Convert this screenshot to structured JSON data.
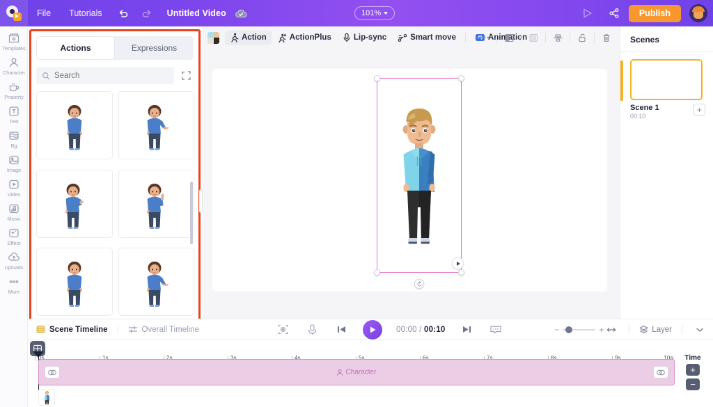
{
  "app": {
    "logo_icon": "animaker-logo-icon",
    "menu": [
      "File",
      "Tutorials"
    ],
    "undo_icon": "undo-icon",
    "redo_icon": "redo-icon",
    "doc_title": "Untitled Video",
    "cloud_icon": "cloud-saved-icon",
    "zoom_level": "101%",
    "preview_icon": "preview-play-icon",
    "share_icon": "share-icon",
    "publish_label": "Publish",
    "avatar_name": "user-avatar",
    "accent_purple": "#7b45ec",
    "publish_orange": "#f6982f"
  },
  "rail": {
    "items": [
      {
        "label": "Templates",
        "icon": "templates-icon"
      },
      {
        "label": "Character",
        "icon": "character-icon"
      },
      {
        "label": "Property",
        "icon": "property-icon"
      },
      {
        "label": "Text",
        "icon": "text-icon"
      },
      {
        "label": "Bg",
        "icon": "background-icon"
      },
      {
        "label": "Image",
        "icon": "image-icon"
      },
      {
        "label": "Video",
        "icon": "video-icon"
      },
      {
        "label": "Music",
        "icon": "music-icon"
      },
      {
        "label": "Effect",
        "icon": "effect-icon"
      },
      {
        "label": "Uploads",
        "icon": "uploads-icon"
      },
      {
        "label": "More",
        "icon": "more-icon"
      }
    ]
  },
  "panel": {
    "highlight_color": "#e8421f",
    "tabs": [
      {
        "label": "Actions",
        "active": true
      },
      {
        "label": "Expressions",
        "active": false
      }
    ],
    "search": {
      "placeholder": "Search",
      "value": "",
      "icon": "search-icon"
    },
    "expand_icon": "expand-icon",
    "thumbnails": [
      {
        "name": "action-thumb-1",
        "pose": "idle"
      },
      {
        "name": "action-thumb-2",
        "pose": "present-right"
      },
      {
        "name": "action-thumb-3",
        "pose": "hand-up"
      },
      {
        "name": "action-thumb-4",
        "pose": "point-up"
      },
      {
        "name": "action-thumb-5",
        "pose": "idle"
      },
      {
        "name": "action-thumb-6",
        "pose": "present-right"
      }
    ]
  },
  "canvas_toolbar": {
    "color_swatch": "color-swatch",
    "buttons": [
      {
        "label": "Action",
        "icon": "action-icon",
        "active": true
      },
      {
        "label": "ActionPlus",
        "icon": "action-plus-icon",
        "active": false
      },
      {
        "label": "Lip-sync",
        "icon": "microphone-icon",
        "active": false
      },
      {
        "label": "Smart move",
        "icon": "smart-move-icon",
        "active": false
      },
      {
        "label": "Animation",
        "icon": "animation-icon",
        "active": false
      }
    ],
    "right_icons": [
      "more-options-icon",
      "flip-icon",
      "transparency-icon",
      "align-icon",
      "lock-icon",
      "delete-icon"
    ]
  },
  "stage": {
    "selection": "character-selection-box",
    "character": "male-character-blue-hoodie",
    "play_chip": "preview-play-chip",
    "rotate_handle": "rotate-handle"
  },
  "scenes": {
    "title": "Scenes",
    "list": [
      {
        "name": "Scene 1",
        "duration": "00:10",
        "active": true
      }
    ],
    "add_label": "+",
    "active_color": "#f0b428"
  },
  "timeline_bar": {
    "scene_timeline_label": "Scene Timeline",
    "overall_timeline_label": "Overall Timeline",
    "icons": {
      "focus": "focus-icon",
      "mic": "microphone-icon",
      "prev": "skip-previous-icon",
      "play": "play-icon",
      "next": "skip-next-icon",
      "caption": "caption-icon",
      "fit": "fit-width-icon",
      "layer": "layers-icon",
      "chevron": "chevron-down-icon"
    },
    "current_time": "00:00",
    "separator": "/",
    "total_time": "00:10",
    "zoom_minus": "−",
    "zoom_plus": "+",
    "layer_label": "Layer"
  },
  "timeline": {
    "split_icon": "split-view-icon",
    "ticks": [
      "0s",
      "1s",
      "2s",
      "3s",
      "4s",
      "5s",
      "6s",
      "7s",
      "8s",
      "9s",
      "10s"
    ],
    "track": {
      "label": "Character",
      "icon": "character-icon",
      "link_icon": "link-icon",
      "color": "#eccde6",
      "border": "#d98fc8"
    },
    "layer_thumb": "character-layer-thumb",
    "time_label": "Time",
    "time_plus": "+",
    "time_minus": "−"
  }
}
